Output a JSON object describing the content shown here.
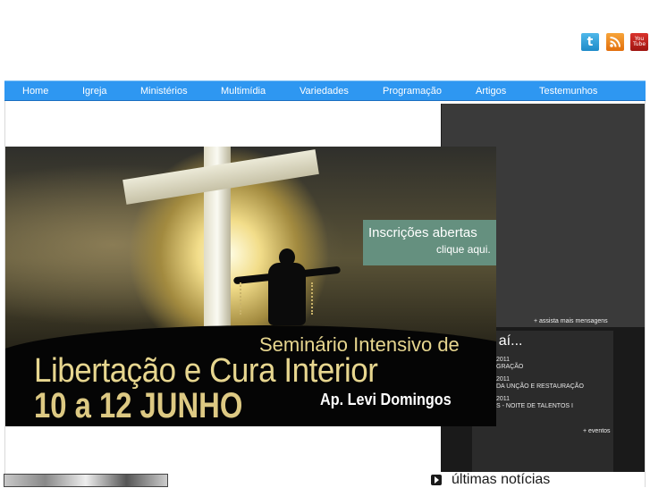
{
  "social": {
    "twitter": "t",
    "youtube_top": "You",
    "youtube_bottom": "Tube",
    "icons": [
      "twitter-icon",
      "rss-icon",
      "youtube-icon"
    ]
  },
  "nav": {
    "items": [
      "Home",
      "Igreja",
      "Ministérios",
      "Multimídia",
      "Variedades",
      "Programação",
      "Artigos",
      "Testemunhos"
    ]
  },
  "video": {
    "more_link": "+ assista mais mensagens"
  },
  "events": {
    "title": "m aí...",
    "items": [
      {
        "date": "2011",
        "name": "GRAÇÃO"
      },
      {
        "date": "2011",
        "name": "DA UNÇÃO E RESTAURAÇÃO"
      },
      {
        "date": "2011",
        "name": "S - NOITE DE TALENTOS I"
      }
    ],
    "more_link": "+ eventos"
  },
  "banner": {
    "cta_line1": "Inscrições abertas",
    "cta_line2": "clique aqui.",
    "line1": "Seminário Intensivo de",
    "line2": "Libertação e Cura Interior",
    "line3": "10 a 12 JUNHO",
    "speaker": "Ap. Levi Domingos"
  },
  "news": {
    "title": "últimas notícias"
  },
  "colors": {
    "nav": "#2e97f1",
    "cta_box": "#65907f",
    "banner_text": "#e7d68f"
  }
}
